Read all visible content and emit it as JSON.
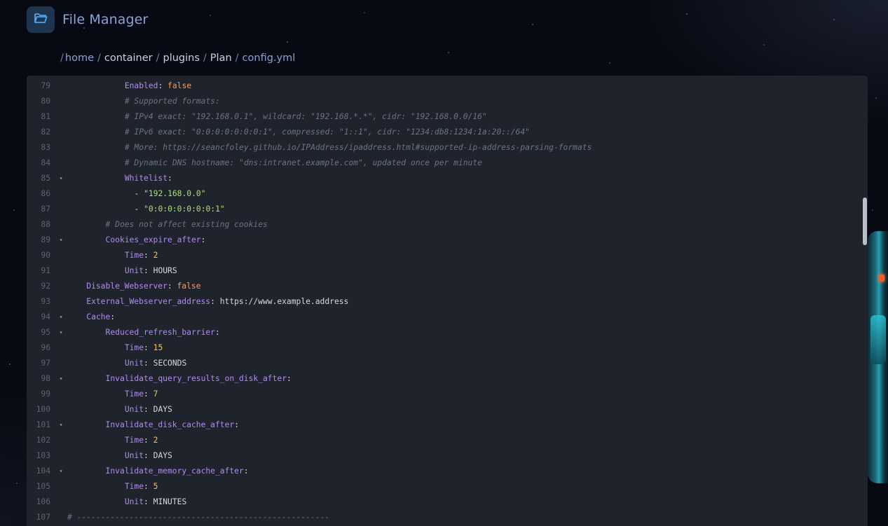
{
  "app": {
    "title": "File Manager",
    "icon": "folder-open-icon"
  },
  "breadcrumb": {
    "separator": "/",
    "items": [
      {
        "label": "home",
        "style": "link"
      },
      {
        "label": "container",
        "style": "plain"
      },
      {
        "label": "plugins",
        "style": "plain"
      },
      {
        "label": "Plan",
        "style": "plain"
      },
      {
        "label": "config.yml",
        "style": "current"
      }
    ]
  },
  "editor": {
    "lines": [
      {
        "num": "79",
        "fold": false,
        "indent": 12,
        "parts": [
          {
            "t": "Enabled",
            "c": "k"
          },
          {
            "t": ": ",
            "c": "p"
          },
          {
            "t": "false",
            "c": "b"
          }
        ]
      },
      {
        "num": "80",
        "fold": false,
        "indent": 12,
        "parts": [
          {
            "t": "# Supported formats:",
            "c": "c"
          }
        ]
      },
      {
        "num": "81",
        "fold": false,
        "indent": 12,
        "parts": [
          {
            "t": "# IPv4 exact: \"192.168.0.1\", wildcard: \"192.168.*.*\", cidr: \"192.168.0.0/16\"",
            "c": "c"
          }
        ]
      },
      {
        "num": "82",
        "fold": false,
        "indent": 12,
        "parts": [
          {
            "t": "# IPv6 exact: \"0:0:0:0:0:0:0:1\", compressed: \"1::1\", cidr: \"1234:db8:1234:1a:20::/64\"",
            "c": "c"
          }
        ]
      },
      {
        "num": "83",
        "fold": false,
        "indent": 12,
        "parts": [
          {
            "t": "# More: https://seancfoley.github.io/IPAddress/ipaddress.html#supported-ip-address-parsing-formats",
            "c": "c"
          }
        ]
      },
      {
        "num": "84",
        "fold": false,
        "indent": 12,
        "parts": [
          {
            "t": "# Dynamic DNS hostname: \"dns:intranet.example.com\", updated once per minute",
            "c": "c"
          }
        ]
      },
      {
        "num": "85",
        "fold": true,
        "indent": 12,
        "parts": [
          {
            "t": "Whitelist",
            "c": "k"
          },
          {
            "t": ":",
            "c": "p"
          }
        ]
      },
      {
        "num": "86",
        "fold": false,
        "indent": 14,
        "parts": [
          {
            "t": "- ",
            "c": "p"
          },
          {
            "t": "\"192.168.0.0\"",
            "c": "s"
          }
        ]
      },
      {
        "num": "87",
        "fold": false,
        "indent": 14,
        "parts": [
          {
            "t": "- ",
            "c": "p"
          },
          {
            "t": "\"0:0:0:0:0:0:0:1\"",
            "c": "s"
          }
        ]
      },
      {
        "num": "88",
        "fold": false,
        "indent": 8,
        "parts": [
          {
            "t": "# Does not affect existing cookies",
            "c": "c"
          }
        ]
      },
      {
        "num": "89",
        "fold": true,
        "indent": 8,
        "parts": [
          {
            "t": "Cookies_expire_after",
            "c": "k"
          },
          {
            "t": ":",
            "c": "p"
          }
        ]
      },
      {
        "num": "90",
        "fold": false,
        "indent": 12,
        "parts": [
          {
            "t": "Time",
            "c": "k"
          },
          {
            "t": ": ",
            "c": "p"
          },
          {
            "t": "2",
            "c": "n"
          }
        ]
      },
      {
        "num": "91",
        "fold": false,
        "indent": 12,
        "parts": [
          {
            "t": "Unit",
            "c": "k"
          },
          {
            "t": ": HOURS",
            "c": "p"
          }
        ]
      },
      {
        "num": "92",
        "fold": false,
        "indent": 4,
        "parts": [
          {
            "t": "Disable_Webserver",
            "c": "k"
          },
          {
            "t": ": ",
            "c": "p"
          },
          {
            "t": "false",
            "c": "b"
          }
        ]
      },
      {
        "num": "93",
        "fold": false,
        "indent": 4,
        "parts": [
          {
            "t": "External_Webserver_address",
            "c": "k"
          },
          {
            "t": ": https://www.example.address",
            "c": "p"
          }
        ]
      },
      {
        "num": "94",
        "fold": true,
        "indent": 4,
        "parts": [
          {
            "t": "Cache",
            "c": "k"
          },
          {
            "t": ":",
            "c": "p"
          }
        ]
      },
      {
        "num": "95",
        "fold": true,
        "indent": 8,
        "parts": [
          {
            "t": "Reduced_refresh_barrier",
            "c": "k"
          },
          {
            "t": ":",
            "c": "p"
          }
        ]
      },
      {
        "num": "96",
        "fold": false,
        "indent": 12,
        "parts": [
          {
            "t": "Time",
            "c": "k"
          },
          {
            "t": ": ",
            "c": "p"
          },
          {
            "t": "15",
            "c": "n"
          }
        ]
      },
      {
        "num": "97",
        "fold": false,
        "indent": 12,
        "parts": [
          {
            "t": "Unit",
            "c": "k"
          },
          {
            "t": ": SECONDS",
            "c": "p"
          }
        ]
      },
      {
        "num": "98",
        "fold": true,
        "indent": 8,
        "parts": [
          {
            "t": "Invalidate_query_results_on_disk_after",
            "c": "k"
          },
          {
            "t": ":",
            "c": "p"
          }
        ]
      },
      {
        "num": "99",
        "fold": false,
        "indent": 12,
        "parts": [
          {
            "t": "Time",
            "c": "k"
          },
          {
            "t": ": ",
            "c": "p"
          },
          {
            "t": "7",
            "c": "n"
          }
        ]
      },
      {
        "num": "100",
        "fold": false,
        "indent": 12,
        "parts": [
          {
            "t": "Unit",
            "c": "k"
          },
          {
            "t": ": DAYS",
            "c": "p"
          }
        ]
      },
      {
        "num": "101",
        "fold": true,
        "indent": 8,
        "parts": [
          {
            "t": "Invalidate_disk_cache_after",
            "c": "k"
          },
          {
            "t": ":",
            "c": "p"
          }
        ]
      },
      {
        "num": "102",
        "fold": false,
        "indent": 12,
        "parts": [
          {
            "t": "Time",
            "c": "k"
          },
          {
            "t": ": ",
            "c": "p"
          },
          {
            "t": "2",
            "c": "n"
          }
        ]
      },
      {
        "num": "103",
        "fold": false,
        "indent": 12,
        "parts": [
          {
            "t": "Unit",
            "c": "k"
          },
          {
            "t": ": DAYS",
            "c": "p"
          }
        ]
      },
      {
        "num": "104",
        "fold": true,
        "indent": 8,
        "parts": [
          {
            "t": "Invalidate_memory_cache_after",
            "c": "k"
          },
          {
            "t": ":",
            "c": "p"
          }
        ]
      },
      {
        "num": "105",
        "fold": false,
        "indent": 12,
        "parts": [
          {
            "t": "Time",
            "c": "k"
          },
          {
            "t": ": ",
            "c": "p"
          },
          {
            "t": "5",
            "c": "n"
          }
        ]
      },
      {
        "num": "106",
        "fold": false,
        "indent": 12,
        "parts": [
          {
            "t": "Unit",
            "c": "k"
          },
          {
            "t": ": MINUTES",
            "c": "p"
          }
        ]
      },
      {
        "num": "107",
        "fold": false,
        "indent": 0,
        "parts": [
          {
            "t": "# -----------------------------------------------------",
            "c": "c"
          }
        ]
      }
    ]
  },
  "colors": {
    "keyword": "#b28bf0",
    "comment": "#6b7385",
    "boolean": "#ff9a52",
    "number": "#f2c46a",
    "string": "#a6e26d",
    "editor_bg": "#1f232c",
    "accent": "#8aa2d6"
  }
}
